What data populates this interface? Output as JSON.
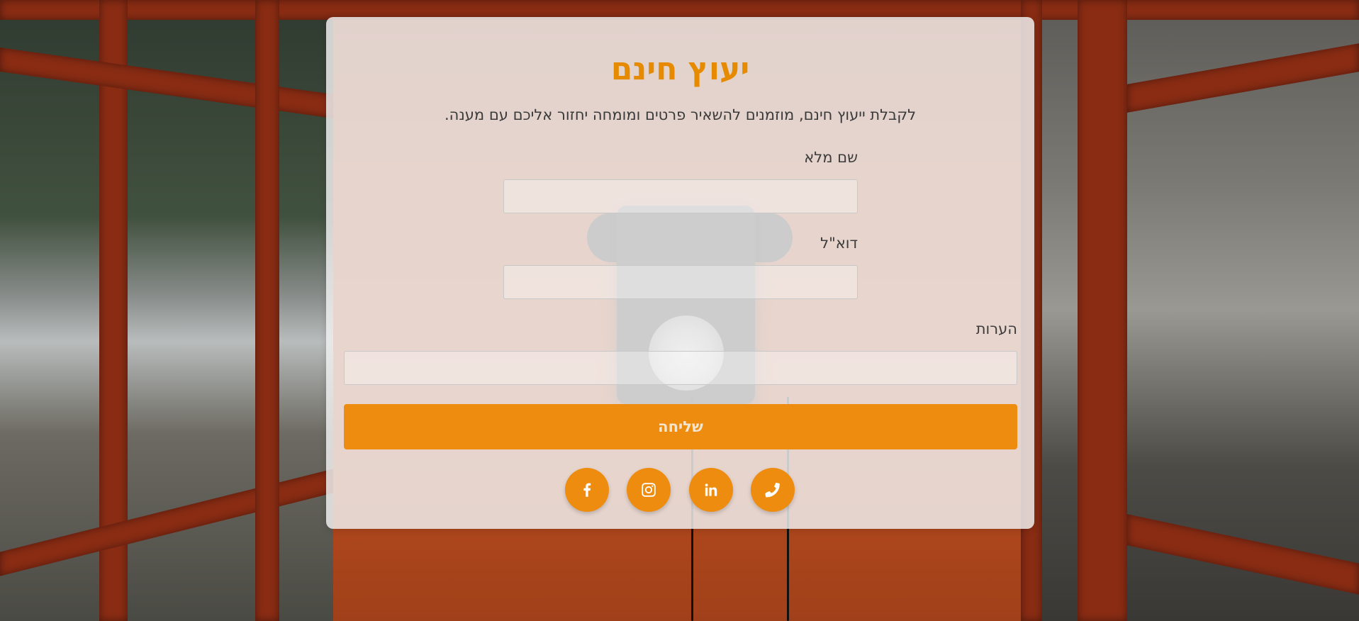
{
  "form": {
    "title": "יעוץ חינם",
    "subtitle": "לקבלת ייעוץ חינם, מוזמנים להשאיר פרטים ומומחה יחזור אליכם עם מענה.",
    "fields": [
      {
        "label": "שם מלא",
        "value": "",
        "placeholder": ""
      },
      {
        "label": "דוא\"ל",
        "value": "",
        "placeholder": ""
      },
      {
        "label": "הערות",
        "value": "",
        "placeholder": ""
      }
    ],
    "submit_label": "שליחה"
  },
  "social": [
    {
      "icon": "facebook-icon"
    },
    {
      "icon": "instagram-icon"
    },
    {
      "icon": "linkedin-icon"
    },
    {
      "icon": "phone-icon"
    }
  ],
  "colors": {
    "accent": "#ee8c10",
    "title": "#e68a00",
    "card_background": "#f0f0f0"
  }
}
